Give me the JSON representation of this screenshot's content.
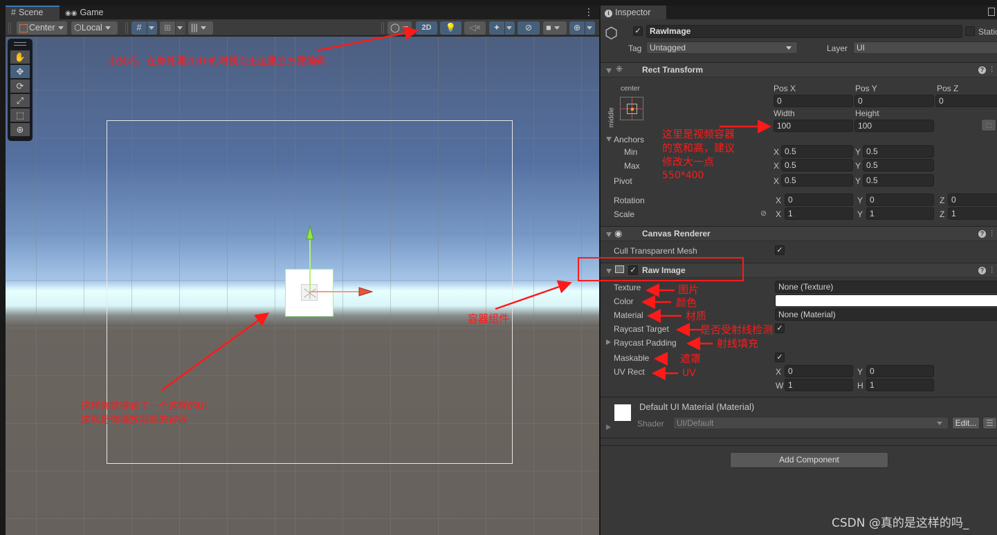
{
  "scene_panel": {
    "tabs": [
      {
        "label": "Scene",
        "icon": "grid-hash-icon",
        "active": true
      },
      {
        "label": "Game",
        "icon": "gamepad-icon",
        "active": false
      }
    ],
    "more_glyph": "⋮",
    "toolbar": {
      "pivot_mode": "Center",
      "pivot_rotation": "Local",
      "btn_2d": "2D",
      "toggle_2d_active": true
    },
    "tools": [
      {
        "name": "hand-tool",
        "glyph": "✋"
      },
      {
        "name": "move-tool",
        "glyph": "✥",
        "selected": true
      },
      {
        "name": "rotate-tool",
        "glyph": "⟳"
      },
      {
        "name": "scale-tool",
        "glyph": "⤢"
      },
      {
        "name": "rect-tool",
        "glyph": "⬚"
      },
      {
        "name": "transform-tool",
        "glyph": "⊕"
      }
    ]
  },
  "annotations": {
    "tip_2d": "小技巧，在你处理2DUI的时候点击这里会方便编辑",
    "container_note_line1": "这样你就得到了一个这样的UI",
    "container_note_line2": "这就是你播放视频的容器",
    "container_component": "容器组件",
    "size_note_line1": "这里是视频容器",
    "size_note_line2": "的宽和高，建议",
    "size_note_line3": "修改大一点",
    "size_note_line4": "550*400",
    "texture_note": "图片",
    "color_note": "颜色",
    "material_note": "材质",
    "raycast_target_note": "是否受射线检测",
    "raycast_padding_note": "射线填充",
    "maskable_note": "遮罩",
    "uv_note": "UV",
    "annotation_color": "#ff1a1a"
  },
  "inspector": {
    "tab_label": "Inspector",
    "object": {
      "active": true,
      "name": "RawImage",
      "static_label": "Static",
      "tag_label": "Tag",
      "tag_value": "Untagged",
      "layer_label": "Layer",
      "layer_value": "UI"
    },
    "rect_transform": {
      "title": "Rect Transform",
      "anchor_preset_h": "center",
      "anchor_preset_v": "middle",
      "pos_x_label": "Pos X",
      "pos_x": "0",
      "pos_y_label": "Pos Y",
      "pos_y": "0",
      "pos_z_label": "Pos Z",
      "pos_z": "0",
      "width_label": "Width",
      "width": "100",
      "height_label": "Height",
      "height": "100",
      "anchors_label": "Anchors",
      "min_label": "Min",
      "min_x": "0.5",
      "min_y": "0.5",
      "max_label": "Max",
      "max_x": "0.5",
      "max_y": "0.5",
      "pivot_label": "Pivot",
      "pivot_x": "0.5",
      "pivot_y": "0.5",
      "rotation_label": "Rotation",
      "rot_x": "0",
      "rot_y": "0",
      "rot_z": "0",
      "scale_label": "Scale",
      "scale_x": "1",
      "scale_y": "1",
      "scale_z": "1",
      "axis_x": "X",
      "axis_y": "Y",
      "axis_z": "Z"
    },
    "canvas_renderer": {
      "title": "Canvas Renderer",
      "cull_label": "Cull Transparent Mesh",
      "cull_checked": true
    },
    "raw_image": {
      "title": "Raw Image",
      "enabled": true,
      "texture_label": "Texture",
      "texture_value": "None (Texture)",
      "color_label": "Color",
      "color_value": "#ffffff",
      "material_label": "Material",
      "material_value": "None (Material)",
      "raycast_target_label": "Raycast Target",
      "raycast_target": true,
      "raycast_padding_label": "Raycast Padding",
      "maskable_label": "Maskable",
      "maskable": true,
      "uv_rect_label": "UV Rect",
      "uv_x": "0",
      "uv_y": "0",
      "uv_w": "1",
      "uv_h": "1",
      "axis_w": "W",
      "axis_h": "H"
    },
    "material": {
      "name": "Default UI Material (Material)",
      "shader_label": "Shader",
      "shader_value": "UI/Default",
      "edit_label": "Edit..."
    },
    "add_component_label": "Add Component"
  },
  "watermark": "CSDN @真的是这样的吗_"
}
